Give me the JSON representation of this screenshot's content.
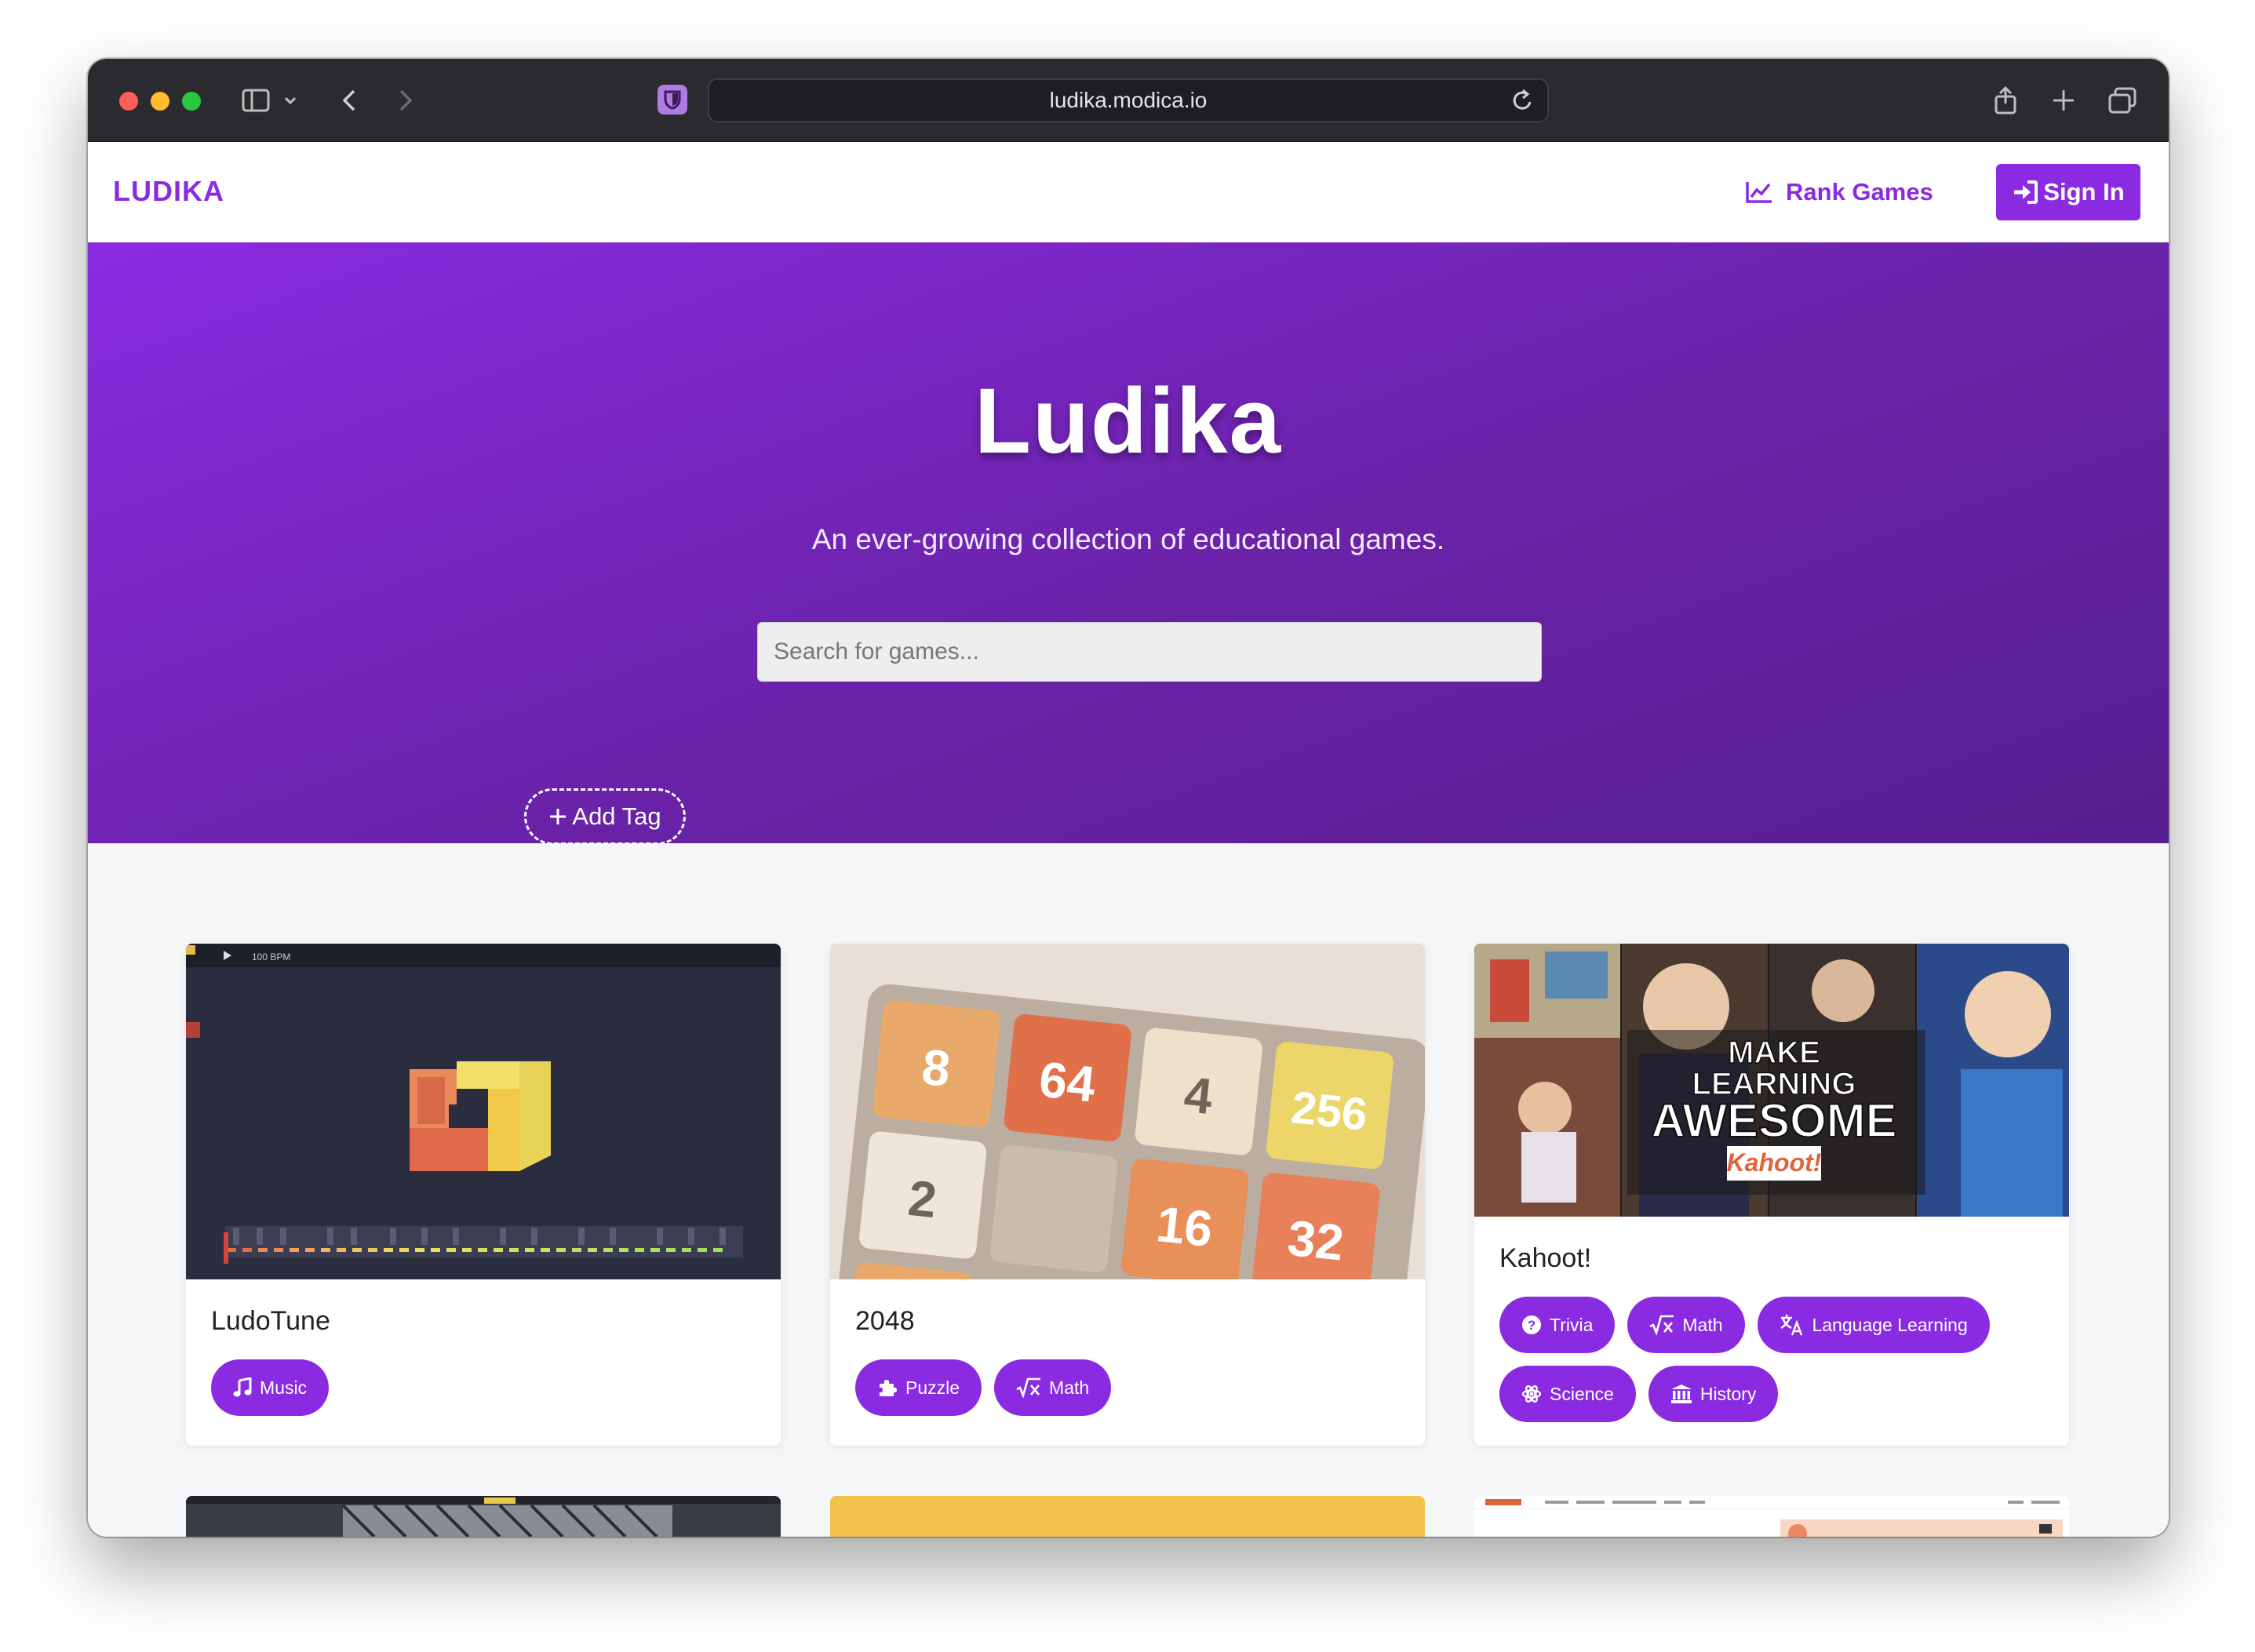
{
  "browser": {
    "url": "ludika.modica.io"
  },
  "header": {
    "brand": "LUDIKA",
    "rank_label": "Rank Games",
    "signin_label": "Sign In"
  },
  "hero": {
    "title": "Ludika",
    "subtitle": "An ever-growing collection of educational games.",
    "search_placeholder": "Search for games...",
    "add_tag_label": "Add Tag"
  },
  "games": [
    {
      "title": "LudoTune",
      "tags": [
        {
          "label": "Music",
          "icon": "music-icon"
        }
      ],
      "thumb_text": "100 BPM"
    },
    {
      "title": "2048",
      "tags": [
        {
          "label": "Puzzle",
          "icon": "puzzle-icon"
        },
        {
          "label": "Math",
          "icon": "math-icon"
        }
      ],
      "tiles": [
        "8",
        "64",
        "4",
        "256",
        "2",
        "16",
        "32"
      ]
    },
    {
      "title": "Kahoot!",
      "tags": [
        {
          "label": "Trivia",
          "icon": "question-icon"
        },
        {
          "label": "Math",
          "icon": "math-icon"
        },
        {
          "label": "Language Learning",
          "icon": "translate-icon"
        },
        {
          "label": "Science",
          "icon": "atom-icon"
        },
        {
          "label": "History",
          "icon": "landmark-icon"
        }
      ],
      "thumb_lines": [
        "MAKE",
        "LEARNING",
        "AWESOME",
        "Kahoot!"
      ]
    }
  ],
  "colors": {
    "accent": "#8a2be2",
    "hero_dark": "#561e8f"
  }
}
